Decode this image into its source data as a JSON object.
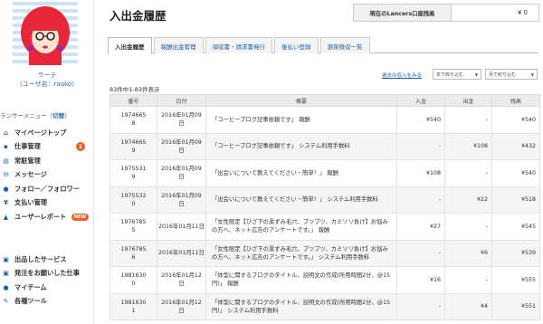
{
  "sidebar": {
    "user_name": "ラーテ",
    "user_id": "（ユーザ名：raako）",
    "menu_head": "ランサーメニュー（",
    "menu_switch": "切替",
    "menu_head_end": "）",
    "items": [
      {
        "icon": "home-icon",
        "glyph": "⌂",
        "label": "マイページトップ"
      },
      {
        "icon": "briefcase-icon",
        "glyph": "▪",
        "label": "仕事管理",
        "badge": "1"
      },
      {
        "icon": "clipboard-icon",
        "glyph": "▤",
        "label": "常駐管理"
      },
      {
        "icon": "envelope-icon",
        "glyph": "✉",
        "label": "メッセージ"
      },
      {
        "icon": "person-icon",
        "glyph": "●",
        "label": "フォロー／フォロワー"
      },
      {
        "icon": "yen-icon",
        "glyph": "¥",
        "label": "支払い管理"
      },
      {
        "icon": "users-icon",
        "glyph": "▲",
        "label": "ユーザーレポート",
        "new_badge": "NEW"
      }
    ],
    "items2": [
      {
        "icon": "cart-icon",
        "glyph": "▣",
        "label": "出品したサービス"
      },
      {
        "icon": "cart-order-icon",
        "glyph": "▣",
        "label": "発注をお願いした仕事"
      },
      {
        "icon": "account-icon",
        "glyph": "●",
        "label": "マイチーム"
      },
      {
        "icon": "wrench-icon",
        "glyph": "✎",
        "label": "各種ツール"
      }
    ]
  },
  "main": {
    "title": "入出金履歴",
    "balance_label": "現在のLancers口座残高",
    "balance_value": "¥ 0",
    "tabs": [
      "入出金履歴",
      "報酬出金管理",
      "領収書・請求書発行",
      "後払い登録",
      "源泉徴収一覧"
    ],
    "filter_link": "過去の収入をみる",
    "select_month_from": "年で絞り込む",
    "select_month_to": "月で絞り込む",
    "count_text": "83件中1-83件表示",
    "columns": [
      "番号",
      "日付",
      "概要",
      "入金",
      "出金",
      "残高"
    ],
    "rows": [
      {
        "id": "1974665\n8",
        "date": "2016年01月09\n日",
        "desc": "「コーヒーブログ記事依頼です」 報酬",
        "in": "¥540",
        "out": "-",
        "bal": "¥540"
      },
      {
        "id": "1974665\n9",
        "date": "2016年01月09\n日",
        "desc": "「コーヒーブログ記事依頼です」 システム利用手数料",
        "in": "-",
        "out": "¥108",
        "bal": "¥432"
      },
      {
        "id": "1975531\n9",
        "date": "2016年01月09\n日",
        "desc": "「出会いについて教えてください・簡単！」 報酬",
        "in": "¥108",
        "out": "-",
        "bal": "¥540"
      },
      {
        "id": "1975532\n0",
        "date": "2016年01月09\n日",
        "desc": "「出会いについて教えてください・簡単！」 システム利用手数料",
        "in": "-",
        "out": "¥22",
        "bal": "¥518"
      },
      {
        "id": "1976785\n5",
        "date": "2016年01月11日",
        "desc": "「女性限定【ひざ下の黒ずみ毛穴、ブツブツ、カミソリ負け】お悩みの方へ、ネット広告のアンケートです。」 報酬",
        "in": "¥27",
        "out": "-",
        "bal": "¥545"
      },
      {
        "id": "1976785\n6",
        "date": "2016年01月11日",
        "desc": "「女性限定【ひざ下の黒ずみ毛穴、ブツブツ、カミソリ負け】お悩みの方へ、ネット広告のアンケートです。」 システム利用手数料",
        "in": "-",
        "out": "¥6",
        "bal": "¥539"
      },
      {
        "id": "1981630\n0",
        "date": "2016年01月12\n日",
        "desc": "「体型に関するブログのタイトル、説明文の作成(所用時間2分、@15円)」 報酬",
        "in": "¥16",
        "out": "-",
        "bal": "¥555"
      },
      {
        "id": "1981630\n1",
        "date": "2016年01月12\n日",
        "desc": "「体型に関するブログのタイトル、説明文の作成(所用時間2分、@15円)」 システム利用手数料",
        "in": "-",
        "out": "¥4",
        "bal": "¥551"
      }
    ]
  },
  "colors": {
    "accent": "#1f5fa8",
    "badge": "#e8622a",
    "avatar_hair": "#e8263a"
  }
}
